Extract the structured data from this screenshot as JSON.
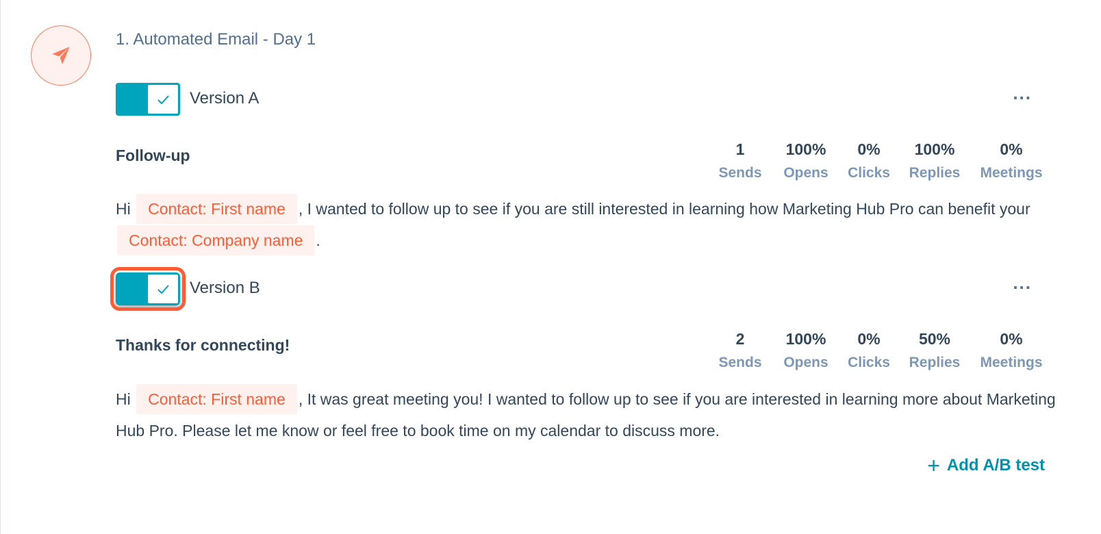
{
  "step": {
    "title": "1. Automated Email - Day 1",
    "icon": "paper-plane-icon"
  },
  "versions": [
    {
      "label": "Version A",
      "toggle_on": true,
      "subject": "Follow-up",
      "stats": [
        {
          "value": "1",
          "label": "Sends"
        },
        {
          "value": "100%",
          "label": "Opens"
        },
        {
          "value": "0%",
          "label": "Clicks"
        },
        {
          "value": "100%",
          "label": "Replies"
        },
        {
          "value": "0%",
          "label": "Meetings"
        }
      ],
      "body": {
        "t1": "Hi",
        "token1": "Contact: First name",
        "t2": ", I wanted to follow up to see if you are still interested in learning how Marketing Hub Pro can benefit your",
        "token2": "Contact: Company name",
        "t3": "."
      }
    },
    {
      "label": "Version B",
      "toggle_on": true,
      "subject": "Thanks for connecting!",
      "stats": [
        {
          "value": "2",
          "label": "Sends"
        },
        {
          "value": "100%",
          "label": "Opens"
        },
        {
          "value": "0%",
          "label": "Clicks"
        },
        {
          "value": "50%",
          "label": "Replies"
        },
        {
          "value": "0%",
          "label": "Meetings"
        }
      ],
      "body": {
        "t1": "Hi",
        "token1": "Contact: First name",
        "t2": ", It was great meeting you! I wanted to follow up to see if you are interested in learning more about Marketing Hub Pro. Please let me know or feel free to book time on my calendar to discuss more."
      }
    }
  ],
  "more_label": "...",
  "add_ab": {
    "plus": "+",
    "label": "Add A/B test"
  },
  "colors": {
    "accent_teal": "#00a4bd",
    "token_orange": "#ff5c35",
    "highlight": "#ff5c35",
    "link": "#0091ae"
  }
}
